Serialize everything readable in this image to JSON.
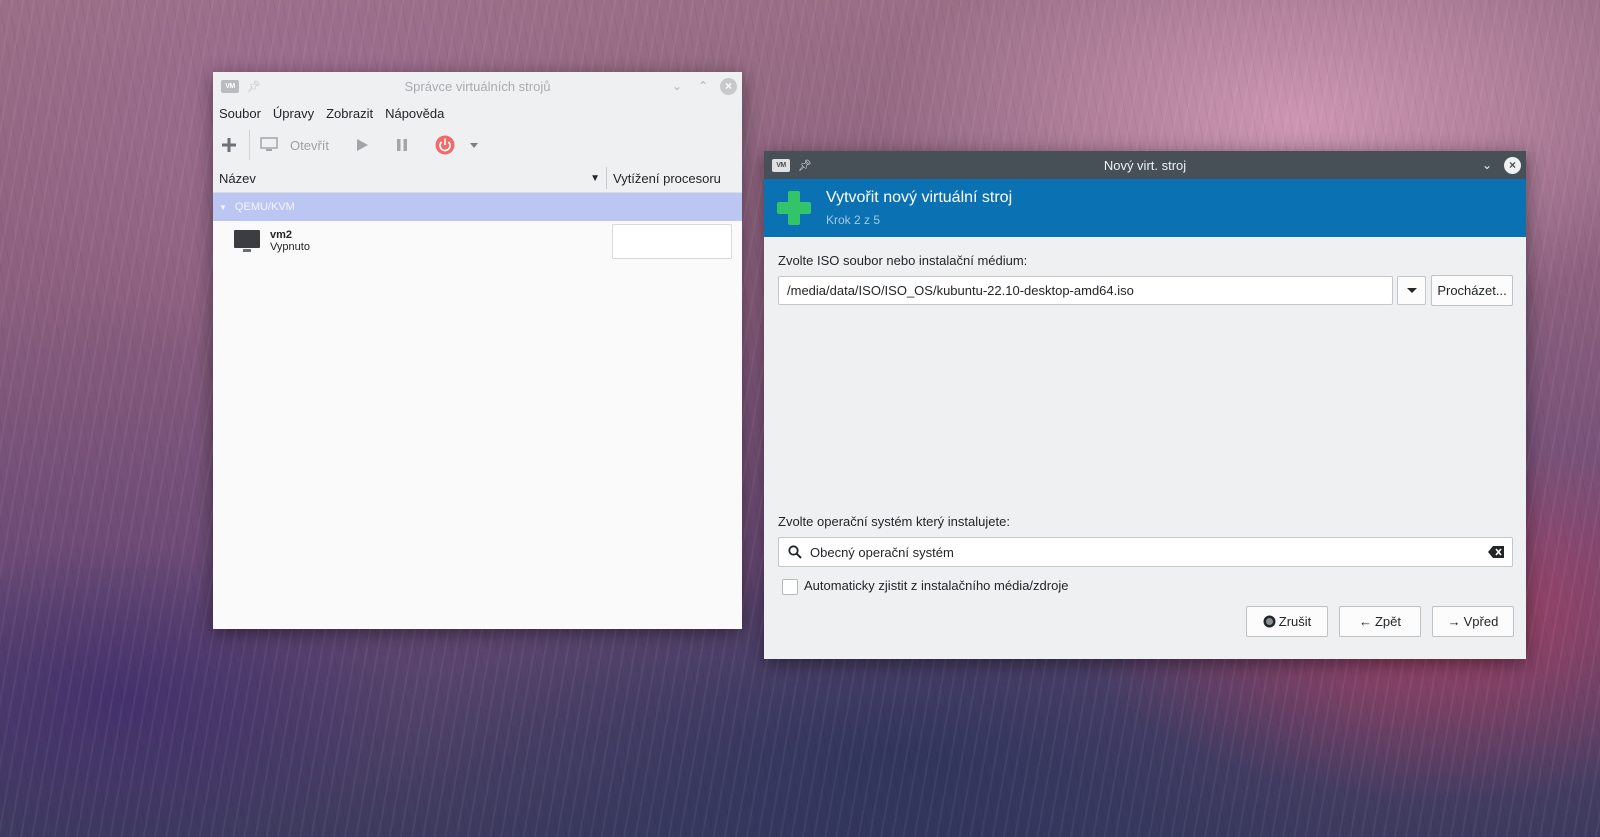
{
  "manager": {
    "title": "Správce virtuálních strojů",
    "app_icon_text": "VM",
    "menu": [
      "Soubor",
      "Úpravy",
      "Zobrazit",
      "Nápověda"
    ],
    "toolbar": {
      "open_label": "Otevřít"
    },
    "columns": {
      "name": "Název",
      "cpu": "Vytížení procesoru"
    },
    "group": "QEMU/KVM",
    "vms": [
      {
        "name": "vm2",
        "status": "Vypnuto"
      }
    ]
  },
  "dialog": {
    "title": "Nový virt. stroj",
    "app_icon_text": "VM",
    "header_title": "Vytvořit nový virtuální stroj",
    "header_step": "Krok 2 z 5",
    "iso_label": "Zvolte ISO soubor nebo instalační médium:",
    "iso_path": "/media/data/ISO/ISO_OS/kubuntu-22.10-desktop-amd64.iso",
    "browse_label": "Procházet...",
    "os_label": "Zvolte operační systém který instalujete:",
    "os_value": "Obecný operační systém",
    "autodetect_label": "Automaticky zjistit z instalačního média/zdroje",
    "autodetect_checked": false,
    "cancel_label": "Zrušit",
    "back_label": "Zpět",
    "forward_label": "Vpřed"
  },
  "colors": {
    "banner": "#0a72b2",
    "plus": "#33c46a",
    "group_row": "#bcc6f3",
    "power": "#f06b6b",
    "dialog_titlebar": "#475057"
  }
}
